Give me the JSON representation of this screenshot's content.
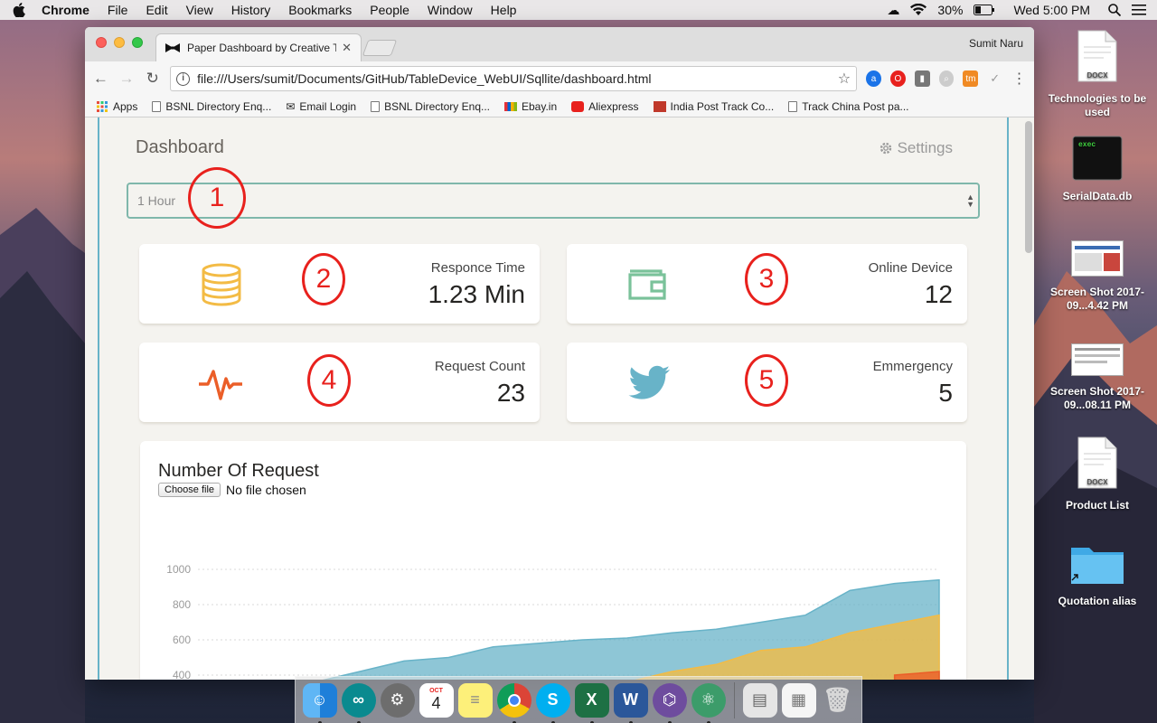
{
  "menubar": {
    "app": "Chrome",
    "items": [
      "File",
      "Edit",
      "View",
      "History",
      "Bookmarks",
      "People",
      "Window",
      "Help"
    ],
    "battery": "30%",
    "clock": "Wed 5:00 PM"
  },
  "browser": {
    "tab_title": "Paper Dashboard by Creative T",
    "profile": "Sumit Naru",
    "url": "file:///Users/sumit/Documents/GitHub/TableDevice_WebUI/Sqllite/dashboard.html",
    "bookmarks": [
      "Apps",
      "BSNL Directory Enq...",
      "Email Login",
      "BSNL Directory Enq...",
      "Ebay.in",
      "Aliexpress",
      "India Post Track Co...",
      "Track China Post pa..."
    ],
    "more": "»"
  },
  "dashboard": {
    "title": "Dashboard",
    "settings": "Settings",
    "select_value": "1 Hour",
    "cards": [
      {
        "label": "Responce Time",
        "value": "1.23 Min",
        "icon": "database-icon",
        "color": "#f3bb45"
      },
      {
        "label": "Online Device",
        "value": "12",
        "icon": "wallet-icon",
        "color": "#7ac29a"
      },
      {
        "label": "Request Count",
        "value": "23",
        "icon": "pulse-icon",
        "color": "#eb5e28"
      },
      {
        "label": "Emmergency",
        "value": "5",
        "icon": "twitter-icon",
        "color": "#68b3c8"
      }
    ],
    "annotations": [
      "1",
      "2",
      "3",
      "4",
      "5"
    ],
    "chart": {
      "title": "Number Of Request",
      "file_button": "Choose file",
      "file_status": "No file chosen"
    }
  },
  "chart_data": {
    "type": "area",
    "title": "Number Of Request",
    "ytick_labels": [
      "1000",
      "800",
      "600",
      "400"
    ],
    "ylim_visible": [
      400,
      1000
    ],
    "series": [
      {
        "color": "#68b3c8",
        "values": [
          300,
          360,
          420,
          480,
          500,
          560,
          580,
          600,
          610,
          640,
          660,
          700,
          740,
          880,
          920,
          940
        ]
      },
      {
        "color": "#f3bb45",
        "values": [
          0,
          0,
          0,
          0,
          0,
          100,
          200,
          300,
          360,
          420,
          460,
          540,
          560,
          640,
          690,
          740
        ]
      },
      {
        "color": "#eb5e28",
        "values": [
          0,
          0,
          0,
          0,
          0,
          0,
          0,
          0,
          0,
          0,
          0,
          0,
          0,
          0,
          400,
          420
        ]
      }
    ]
  },
  "desktop": {
    "icons": [
      {
        "label": "Technologies to be used",
        "badge": "DOCX"
      },
      {
        "label": "SerialData.db",
        "badge": "exec"
      },
      {
        "label": "Screen Shot 2017-09...4.42 PM"
      },
      {
        "label": "Screen Shot 2017-09...08.11 PM"
      },
      {
        "label": "Product List",
        "badge": "DOCX"
      },
      {
        "label": "Quotation alias"
      }
    ]
  },
  "dock": {
    "calendar_month": "OCT",
    "calendar_day": "4"
  }
}
